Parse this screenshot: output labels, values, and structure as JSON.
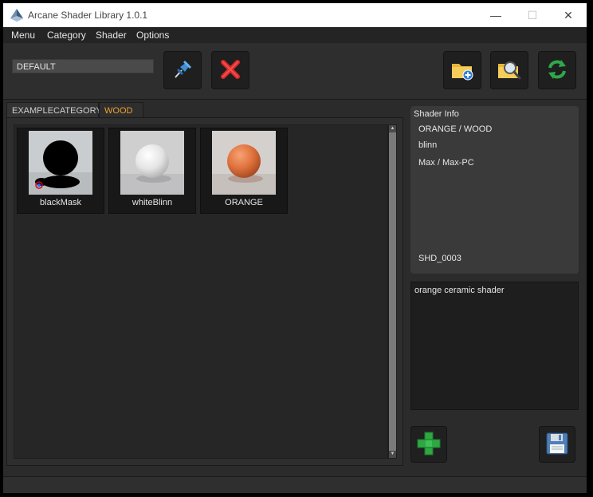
{
  "window": {
    "title": "Arcane Shader Library 1.0.1",
    "controls": {
      "minimize": "—",
      "maximize": "☐",
      "close": "✕"
    },
    "app_icon": "pyramid-icon"
  },
  "menubar": {
    "items": [
      {
        "label": "Menu"
      },
      {
        "label": "Category"
      },
      {
        "label": "Shader"
      },
      {
        "label": "Options"
      }
    ]
  },
  "toolbar": {
    "preset_value": "DEFAULT",
    "buttons": [
      {
        "icon": "pin-icon"
      },
      {
        "icon": "delete-x-icon"
      },
      {
        "icon": "folder-add-icon"
      },
      {
        "icon": "folder-search-icon"
      },
      {
        "icon": "refresh-icon"
      }
    ]
  },
  "tabs": [
    {
      "label": "EXAMPLECATEGORY",
      "active": false
    },
    {
      "label": "WOOD",
      "active": true
    }
  ],
  "shaders": [
    {
      "name": "blackMask",
      "thumb": "black-sphere"
    },
    {
      "name": "whiteBlinn",
      "thumb": "white-sphere"
    },
    {
      "name": "ORANGE",
      "thumb": "orange-sphere"
    }
  ],
  "info": {
    "header": "Shader Info",
    "name_category": "ORANGE / WOOD",
    "material_type": "blinn",
    "renderer": "Max / Max-PC",
    "id": "SHD_0003"
  },
  "description": "orange ceramic shader",
  "bottom_buttons": [
    {
      "icon": "add-plus-icon"
    },
    {
      "icon": "save-disk-icon"
    }
  ],
  "colors": {
    "accent_tab": "#f0a030",
    "background": "#2b2b2b",
    "orange_sphere": "#e0733e"
  }
}
